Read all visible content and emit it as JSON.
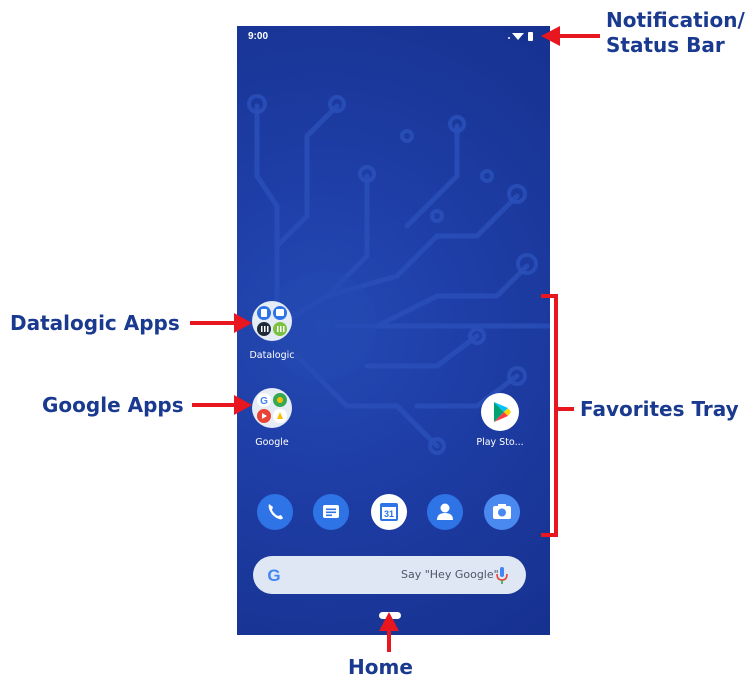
{
  "status_bar": {
    "time": "9:00"
  },
  "folders": [
    {
      "label": "Datalogic"
    },
    {
      "label": "Google"
    }
  ],
  "apps": [
    {
      "label": "Play Sto..."
    }
  ],
  "dock": [
    {
      "icon": "phone-icon"
    },
    {
      "icon": "messages-icon"
    },
    {
      "icon": "calendar-icon",
      "text": "31"
    },
    {
      "icon": "contacts-icon"
    },
    {
      "icon": "camera-icon"
    }
  ],
  "search": {
    "hint": "Say \"Hey Google\"",
    "logo": "G"
  },
  "callouts": {
    "notification_line1": "Notification/",
    "notification_line2": "Status Bar",
    "datalogic": "Datalogic Apps",
    "google": "Google Apps",
    "favorites": "Favorites Tray",
    "home": "Home"
  },
  "colors": {
    "background": "#1f3fa8",
    "callout_text": "#1a3a8f",
    "arrow": "#e8161f",
    "dock_icon": "#2f74e6"
  }
}
